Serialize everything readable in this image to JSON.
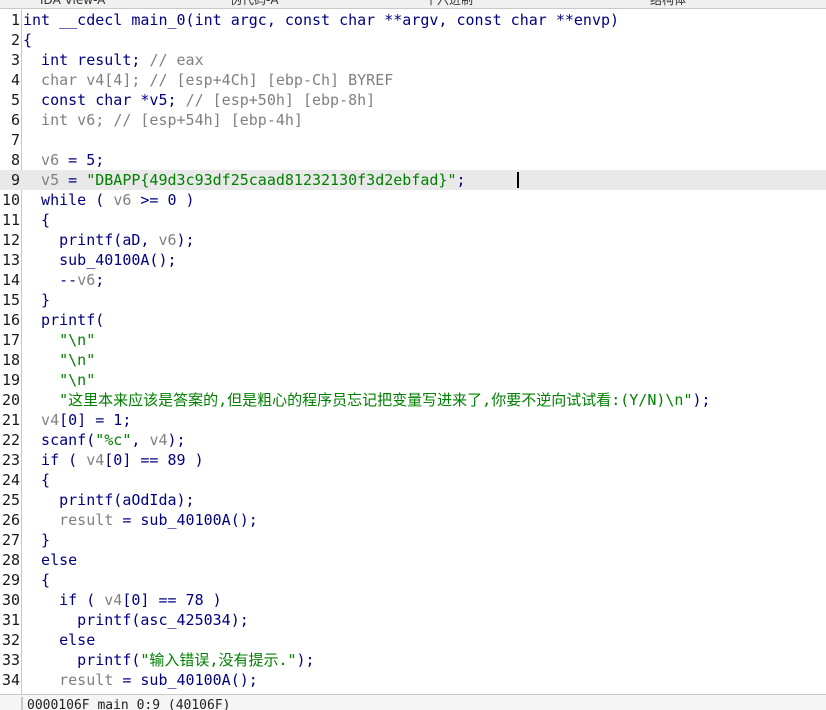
{
  "tabs": [
    {
      "label": "IDA View-A"
    },
    {
      "label": "伪代码-A"
    },
    {
      "label": "十六进制"
    },
    {
      "label": "结构体"
    }
  ],
  "code_lines": [
    {
      "num": "1",
      "segs": [
        [
          "k",
          "int __cdecl main_0(int argc, const char **argv, const char **envp)"
        ]
      ]
    },
    {
      "num": "2",
      "segs": [
        [
          "k",
          "{"
        ]
      ]
    },
    {
      "num": "3",
      "segs": [
        [
          "k",
          "  int result; "
        ],
        [
          "c",
          "// eax"
        ]
      ]
    },
    {
      "num": "4",
      "segs": [
        [
          "v",
          "  char v4[4]; "
        ],
        [
          "c",
          "// [esp+4Ch] [ebp-Ch] BYREF"
        ]
      ]
    },
    {
      "num": "5",
      "segs": [
        [
          "k",
          "  const char *v5; "
        ],
        [
          "c",
          "// [esp+50h] [ebp-8h]"
        ]
      ]
    },
    {
      "num": "6",
      "segs": [
        [
          "v",
          "  int v6; "
        ],
        [
          "c",
          "// [esp+54h] [ebp-4h]"
        ]
      ]
    },
    {
      "num": "7",
      "segs": [
        [
          "k",
          ""
        ]
      ]
    },
    {
      "num": "8",
      "segs": [
        [
          "v",
          "  v6"
        ],
        [
          "k",
          " = 5;"
        ]
      ]
    },
    {
      "num": "9",
      "segs": [
        [
          "v",
          "  v5"
        ],
        [
          "k",
          " = "
        ],
        [
          "s",
          "\"DBAPP{49d3c93df25caad81232130f3d2ebfad}\""
        ],
        [
          "k",
          ";"
        ]
      ],
      "hl": true
    },
    {
      "num": "10",
      "segs": [
        [
          "k",
          "  while ( "
        ],
        [
          "v",
          "v6"
        ],
        [
          "k",
          " >= 0 )"
        ]
      ]
    },
    {
      "num": "11",
      "segs": [
        [
          "k",
          "  {"
        ]
      ]
    },
    {
      "num": "12",
      "segs": [
        [
          "k",
          "    printf(aD, "
        ],
        [
          "v",
          "v6"
        ],
        [
          "k",
          ");"
        ]
      ]
    },
    {
      "num": "13",
      "segs": [
        [
          "k",
          "    sub_40100A();"
        ]
      ]
    },
    {
      "num": "14",
      "segs": [
        [
          "k",
          "    --"
        ],
        [
          "v",
          "v6"
        ],
        [
          "k",
          ";"
        ]
      ]
    },
    {
      "num": "15",
      "segs": [
        [
          "k",
          "  }"
        ]
      ]
    },
    {
      "num": "16",
      "segs": [
        [
          "k",
          "  printf("
        ]
      ]
    },
    {
      "num": "17",
      "segs": [
        [
          "s",
          "    \"\\n\""
        ]
      ]
    },
    {
      "num": "18",
      "segs": [
        [
          "s",
          "    \"\\n\""
        ]
      ]
    },
    {
      "num": "19",
      "segs": [
        [
          "s",
          "    \"\\n\""
        ]
      ]
    },
    {
      "num": "20",
      "segs": [
        [
          "s",
          "    \"这里本来应该是答案的,但是粗心的程序员忘记把变量写进来了,你要不逆向试试看:(Y/N)\\n\""
        ],
        [
          "k",
          ");"
        ]
      ]
    },
    {
      "num": "21",
      "segs": [
        [
          "v",
          "  v4"
        ],
        [
          "k",
          "[0] = 1;"
        ]
      ]
    },
    {
      "num": "22",
      "segs": [
        [
          "k",
          "  scanf("
        ],
        [
          "s",
          "\"%c\""
        ],
        [
          "k",
          ", "
        ],
        [
          "v",
          "v4"
        ],
        [
          "k",
          ");"
        ]
      ]
    },
    {
      "num": "23",
      "segs": [
        [
          "k",
          "  if ( "
        ],
        [
          "v",
          "v4"
        ],
        [
          "k",
          "[0] == 89 )"
        ]
      ]
    },
    {
      "num": "24",
      "segs": [
        [
          "k",
          "  {"
        ]
      ]
    },
    {
      "num": "25",
      "segs": [
        [
          "k",
          "    printf(aOdIda);"
        ]
      ]
    },
    {
      "num": "26",
      "segs": [
        [
          "v",
          "    result"
        ],
        [
          "k",
          " = sub_40100A();"
        ]
      ]
    },
    {
      "num": "27",
      "segs": [
        [
          "k",
          "  }"
        ]
      ]
    },
    {
      "num": "28",
      "segs": [
        [
          "k",
          "  else"
        ]
      ]
    },
    {
      "num": "29",
      "segs": [
        [
          "k",
          "  {"
        ]
      ]
    },
    {
      "num": "30",
      "segs": [
        [
          "k",
          "    if ( "
        ],
        [
          "v",
          "v4"
        ],
        [
          "k",
          "[0] == 78 )"
        ]
      ]
    },
    {
      "num": "31",
      "segs": [
        [
          "k",
          "      printf(asc_425034);"
        ]
      ]
    },
    {
      "num": "32",
      "segs": [
        [
          "k",
          "    else"
        ]
      ]
    },
    {
      "num": "33",
      "segs": [
        [
          "k",
          "      printf("
        ],
        [
          "s",
          "\"输入错误,没有提示.\""
        ],
        [
          "k",
          ");"
        ]
      ]
    },
    {
      "num": "34",
      "segs": [
        [
          "v",
          "    result"
        ],
        [
          "k",
          " = sub_40100A();"
        ]
      ]
    }
  ],
  "status": {
    "location": "0000106F main_0:9 (40106F)"
  },
  "colors": {
    "keyword": "#000080",
    "variable": "#808080",
    "string": "#008000",
    "highlight": "#e9e9e9"
  }
}
